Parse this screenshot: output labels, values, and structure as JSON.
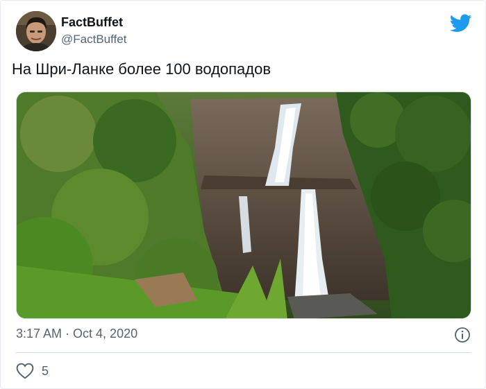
{
  "tweet": {
    "author_name": "FactBuffet",
    "author_handle": "@FactBuffet",
    "text": "На Шри-Ланке более 100 водопадов",
    "timestamp": "3:17 AM · Oct 4, 2020",
    "like_count": "5"
  },
  "icons": {
    "brand": "twitter-bird-icon",
    "info": "info-icon",
    "like": "heart-icon"
  },
  "colors": {
    "brand_blue": "#1d9bf0",
    "secondary_text": "#536471",
    "primary_text": "#0f1419",
    "divider": "#cfd9de"
  }
}
